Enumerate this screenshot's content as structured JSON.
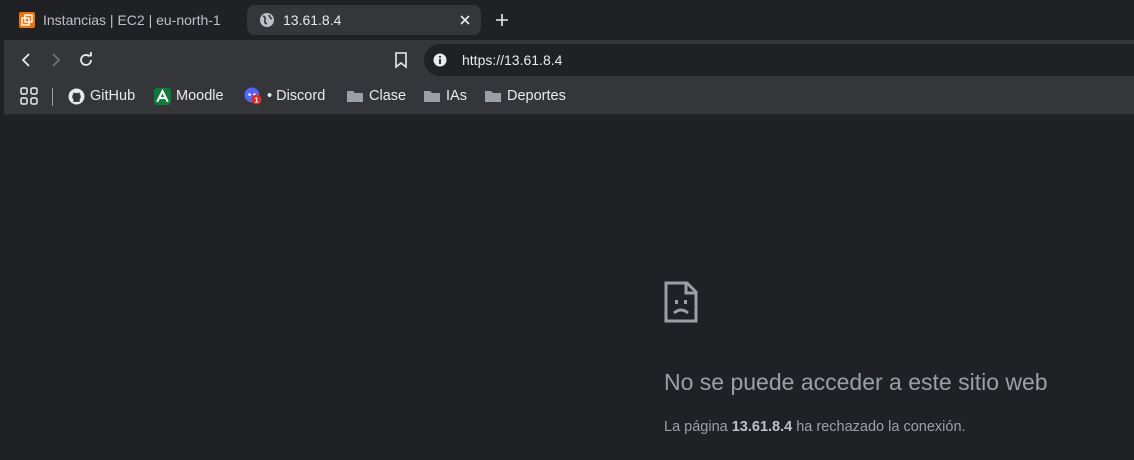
{
  "tabs": [
    {
      "title": "Instancias | EC2 | eu-north-1",
      "icon": "aws-favicon-icon",
      "active": false
    },
    {
      "title": "13.61.8.4",
      "icon": "globe-icon",
      "active": true
    }
  ],
  "toolbar": {
    "url": "https://13.61.8.4",
    "buttons": [
      "back-icon",
      "forward-icon",
      "reload-icon",
      "bookmark-icon",
      "info-icon"
    ]
  },
  "bookmarks": {
    "apps_icon": "apps-grid-icon",
    "items": [
      {
        "label": "GitHub",
        "icon": "github-icon"
      },
      {
        "label": "Moodle",
        "icon": "moodle-icon"
      },
      {
        "label": "• Discord",
        "icon": "discord-icon",
        "badge": "1"
      },
      {
        "label": "Clase",
        "icon": "folder-icon"
      },
      {
        "label": "IAs",
        "icon": "folder-icon"
      },
      {
        "label": "Deportes",
        "icon": "folder-icon"
      }
    ]
  },
  "error": {
    "icon": "sad-page-icon",
    "title": "No se puede acceder a este sitio web",
    "desc_prefix": "La página ",
    "desc_host": "13.61.8.4",
    "desc_suffix": " ha rechazado la conexión."
  },
  "colors": {
    "background": "#202124",
    "toolbar": "#35363a",
    "text": "#e8eaed",
    "muted": "#9aa0a6",
    "aws_orange": "#e8760c",
    "moodle_green": "#0f7b3a",
    "discord_blurple": "#5865f2",
    "badge_red": "#d93025"
  }
}
